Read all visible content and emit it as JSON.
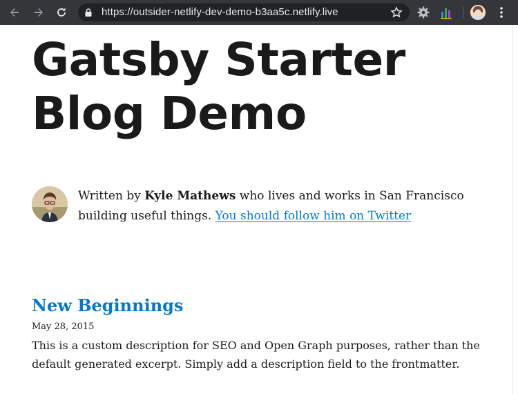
{
  "browser": {
    "url": "https://outsider-netlify-dev-demo-b3aa5c.netlify.live",
    "icons": [
      "back-icon",
      "forward-icon",
      "reload-icon",
      "lock-icon",
      "star-icon",
      "gear-extension-icon",
      "chart-extension-icon",
      "profile-avatar",
      "menu-icon"
    ],
    "colors": {
      "toolbar": "#35363a",
      "omnibox": "#202124",
      "text": "#e8eaed"
    }
  },
  "site": {
    "title_line1": "Gatsby Starter",
    "title_line2": "Blog Demo"
  },
  "bio": {
    "prefix": "Written by ",
    "author": "Kyle Mathews",
    "suffix": " who lives and works in San Francisco building useful things. ",
    "link_text": "You should follow him on Twitter"
  },
  "posts": [
    {
      "title": "New Beginnings",
      "date": "May 28, 2015",
      "description": "This is a custom description for SEO and Open Graph purposes, rather than the default generated excerpt. Simply add a description field to the frontmatter."
    }
  ],
  "colors": {
    "link": "#007acc",
    "text": "#1a1a1a"
  }
}
